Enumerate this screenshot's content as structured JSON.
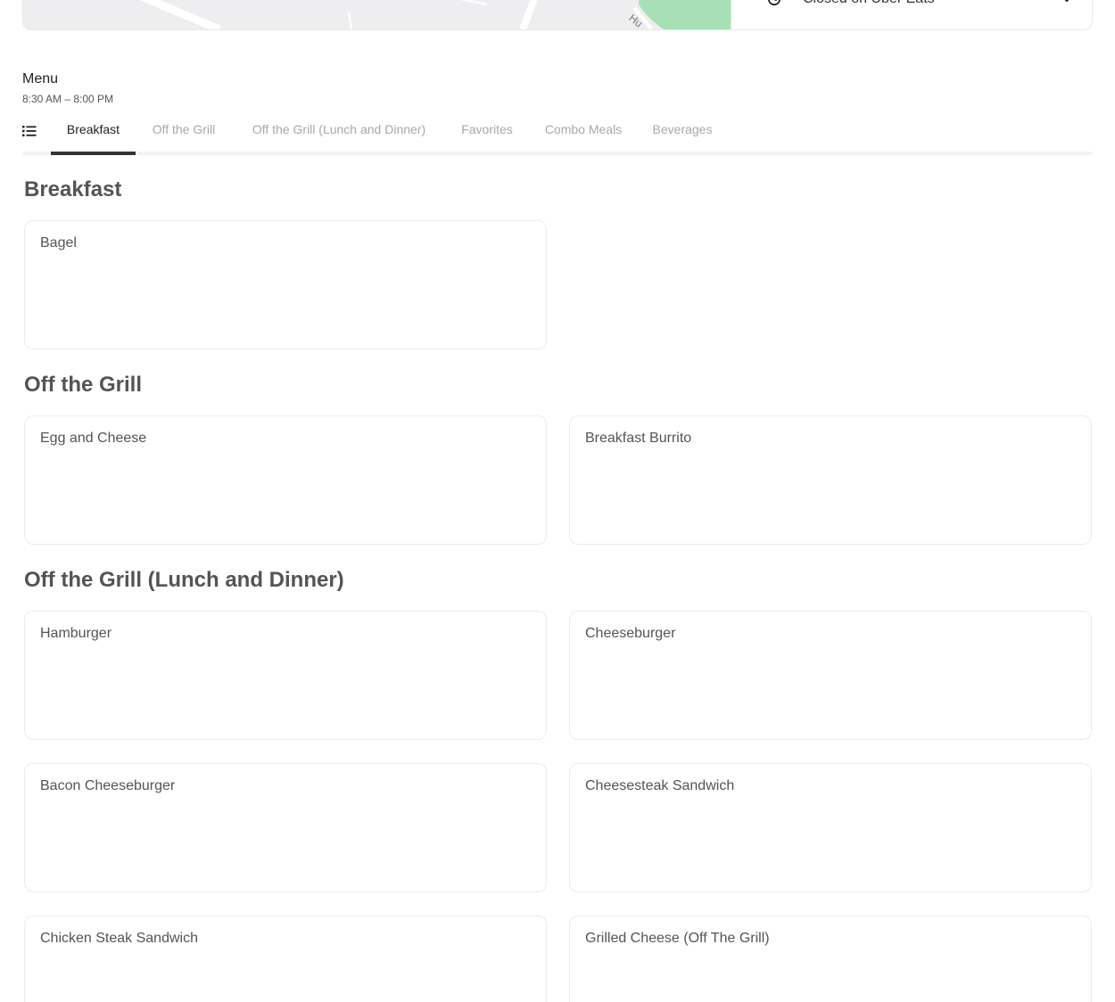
{
  "store": {
    "status_text": "Closed on Uber Eats",
    "map_street_label": "Hu"
  },
  "menu": {
    "title": "Menu",
    "hours": "8:30 AM – 8:00 PM"
  },
  "tabs": [
    {
      "label": "Breakfast",
      "active": true
    },
    {
      "label": "Off the Grill",
      "active": false
    },
    {
      "label": "Off the Grill (Lunch and Dinner)",
      "active": false
    },
    {
      "label": "Favorites",
      "active": false
    },
    {
      "label": "Combo Meals",
      "active": false
    },
    {
      "label": "Beverages",
      "active": false
    }
  ],
  "sections": [
    {
      "title": "Breakfast",
      "items": [
        "Bagel"
      ]
    },
    {
      "title": "Off the Grill",
      "items": [
        "Egg and Cheese",
        "Breakfast Burrito"
      ]
    },
    {
      "title": "Off the Grill (Lunch and Dinner)",
      "items": [
        "Hamburger",
        "Cheeseburger",
        "Bacon Cheeseburger",
        "Cheesesteak Sandwich",
        "Chicken Steak Sandwich",
        "Grilled Cheese (Off The Grill)"
      ]
    }
  ],
  "colors": {
    "map_background": "#eeeef1",
    "map_park": "#a8e0b5",
    "active_tab_underline": "#333333",
    "inactive_tab_text": "#a8a8a8"
  },
  "icons": {
    "hours": "clock-icon",
    "expand": "chevron-down-icon",
    "tabs_menu": "list-icon"
  }
}
